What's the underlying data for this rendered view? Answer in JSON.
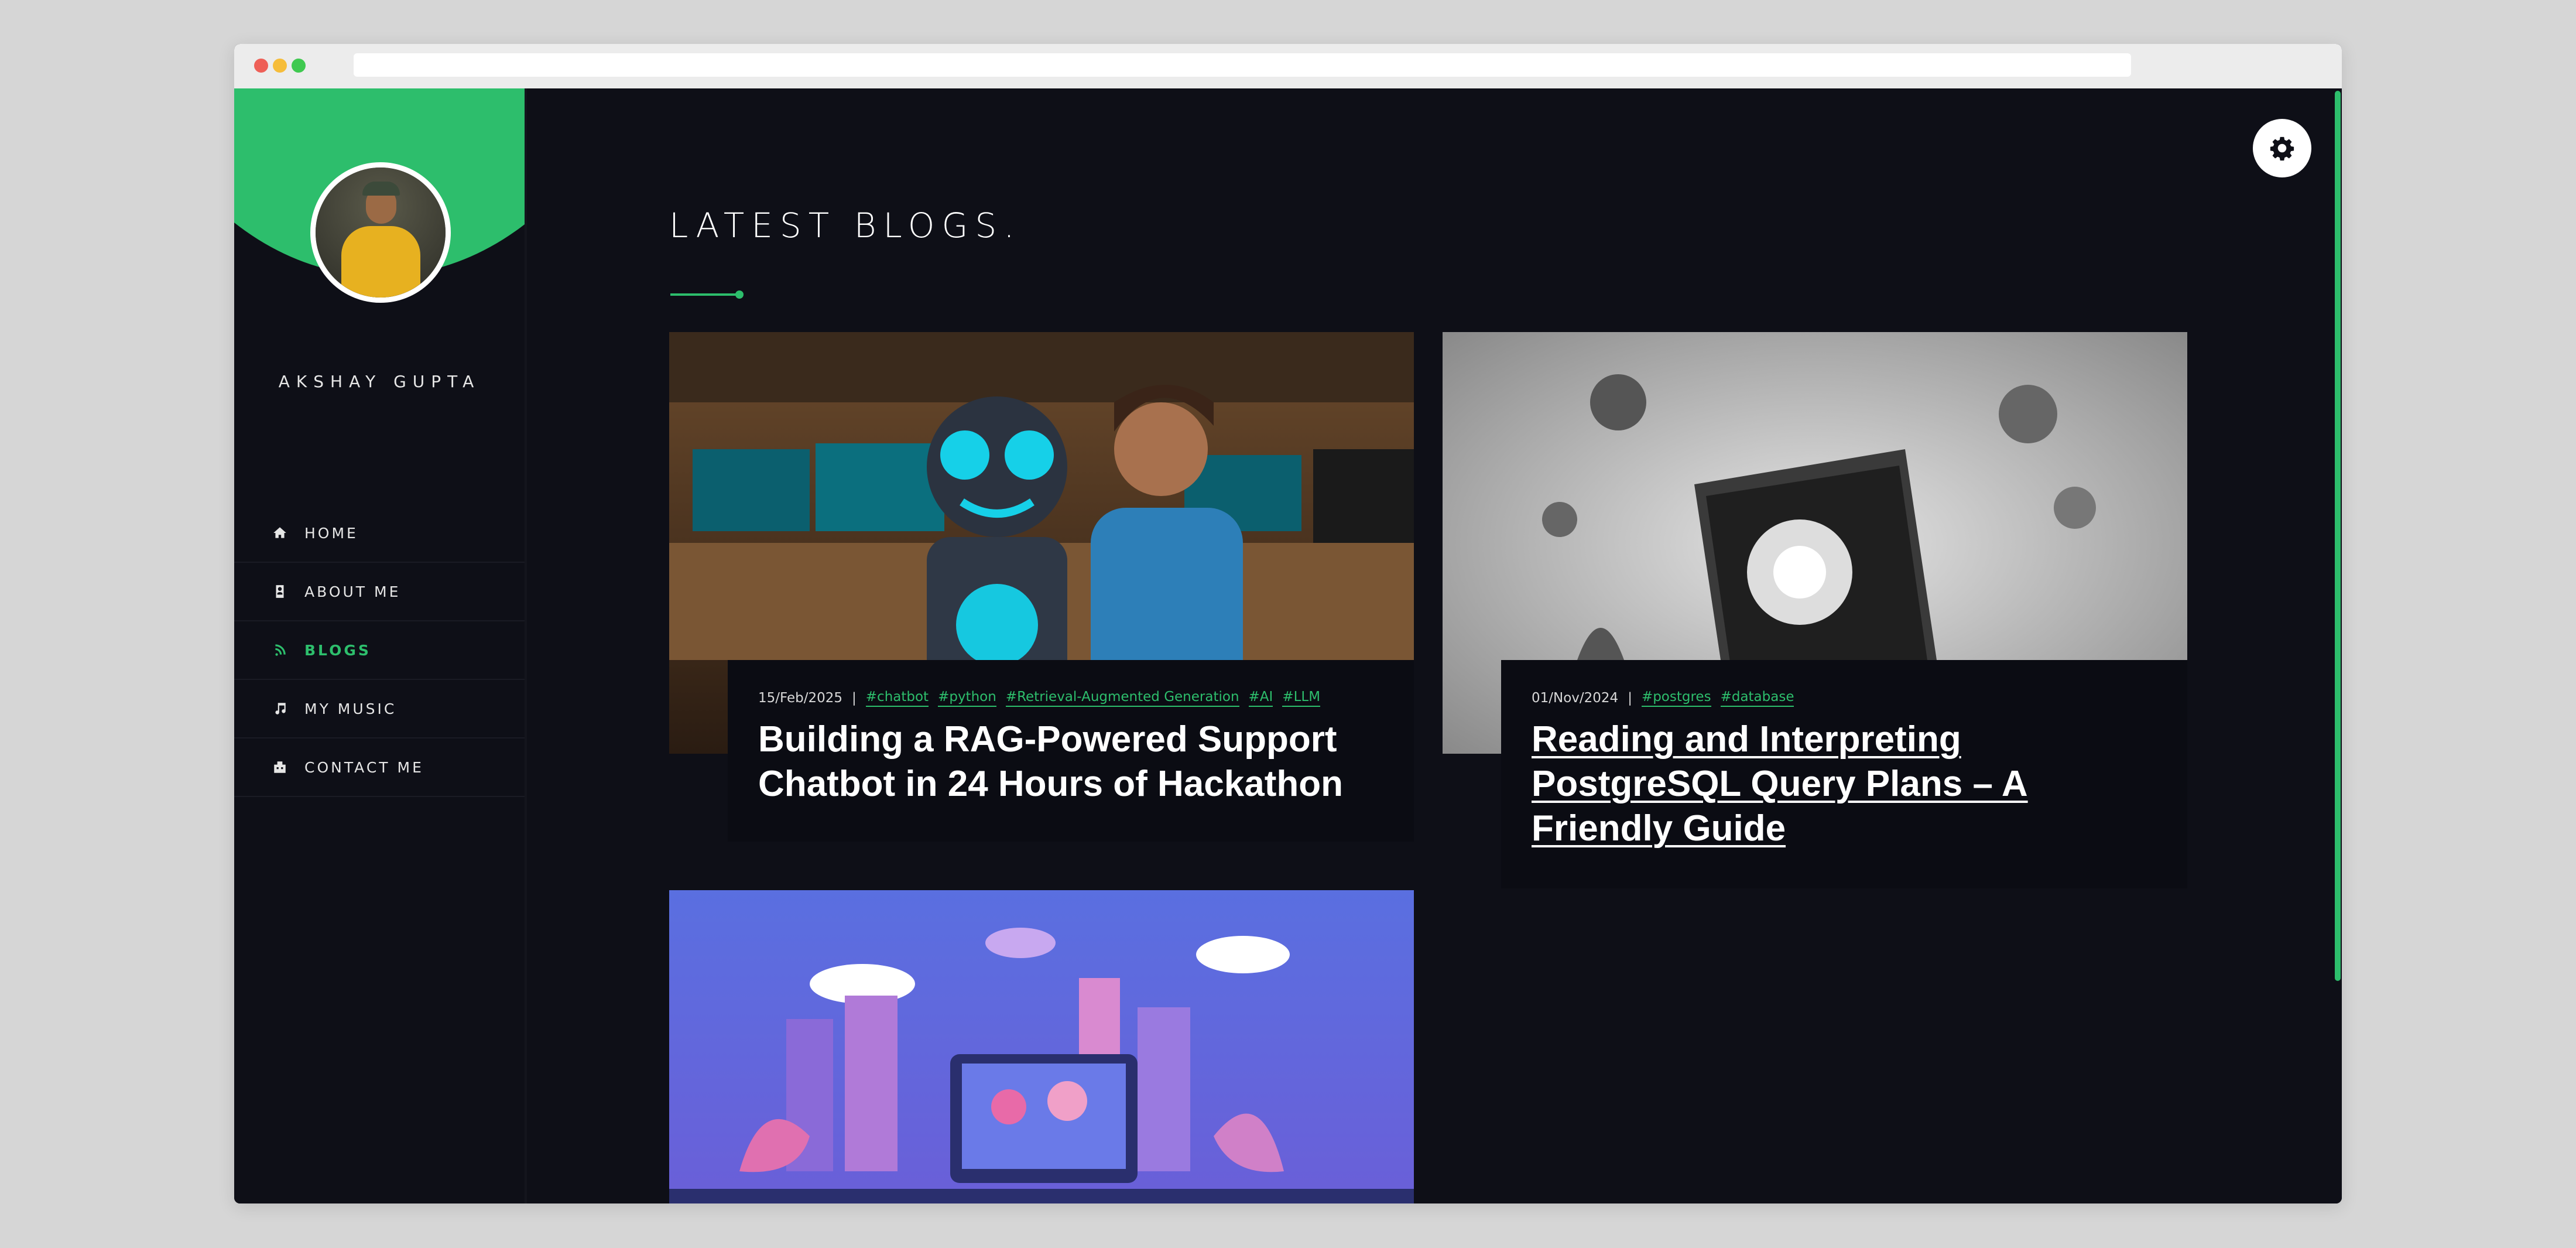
{
  "profile": {
    "name": "AKSHAY GUPTA"
  },
  "nav": {
    "items": [
      {
        "label": "HOME",
        "icon": "home-icon",
        "active": false
      },
      {
        "label": "ABOUT ME",
        "icon": "id-card-icon",
        "active": false
      },
      {
        "label": "BLOGS",
        "icon": "blog-icon",
        "active": true
      },
      {
        "label": "MY MUSIC",
        "icon": "music-note-icon",
        "active": false
      },
      {
        "label": "CONTACT ME",
        "icon": "contact-icon",
        "active": false
      }
    ]
  },
  "socials": [
    "github-icon",
    "linkedin-icon",
    "medium-icon",
    "dev-icon",
    "instagram-icon",
    "facebook-icon",
    "soundcloud-icon"
  ],
  "main": {
    "section_title": "LATEST BLOGS.",
    "posts": [
      {
        "date": "15/Feb/2025",
        "tags": [
          "#chatbot",
          "#python",
          "#Retrieval-Augmented Generation",
          "#AI",
          "#LLM"
        ],
        "title": "Building a RAG-Powered Support Chatbot in 24 Hours of Hackathon"
      },
      {
        "date": "01/Nov/2024",
        "tags": [
          "#postgres",
          "#database"
        ],
        "title": "Reading and Interpreting PostgreSQL Query Plans – A Friendly Guide"
      }
    ]
  },
  "colors": {
    "accent": "#2dbe6c",
    "background": "#0e0f17",
    "panel": "#0b0c13"
  },
  "icons": {
    "theme_toggle": "gear-icon"
  }
}
